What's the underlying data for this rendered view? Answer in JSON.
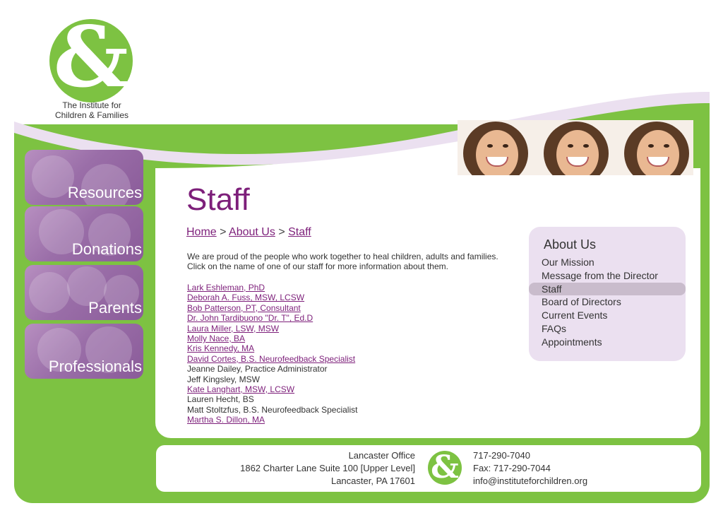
{
  "logo": {
    "symbol": "&",
    "line1": "The Institute for",
    "line2": "Children & Families"
  },
  "colors": {
    "brand_green": "#7dc242",
    "brand_purple": "#7d1f7a",
    "lavender": "#ebe0f0"
  },
  "sidebar": {
    "items": [
      {
        "label": "Resources"
      },
      {
        "label": "Donations"
      },
      {
        "label": "Parents"
      },
      {
        "label": "Professionals"
      }
    ]
  },
  "page": {
    "title": "Staff",
    "breadcrumb": {
      "home": "Home",
      "sep1": ">",
      "about": "About Us",
      "sep2": ">",
      "current": "Staff"
    },
    "intro_line1": "We are proud of the people who work together to heal children, adults and families.",
    "intro_line2": "Click on the name of one of our staff for more information about them."
  },
  "staff": [
    {
      "name": "Lark Eshleman, PhD",
      "linked": true
    },
    {
      "name": "Deborah A. Fuss, MSW, LCSW",
      "linked": true
    },
    {
      "name": "Bob Patterson, PT, Consultant",
      "linked": true
    },
    {
      "name": "Dr. John Tardibuono \"Dr. T\", Ed.D",
      "linked": true
    },
    {
      "name": "Laura Miller, LSW, MSW",
      "linked": true
    },
    {
      "name": "Molly Nace, BA",
      "linked": true
    },
    {
      "name": "Kris Kennedy, MA",
      "linked": true
    },
    {
      "name": "David Cortes, B.S. Neurofeedback Specialist",
      "linked": true
    },
    {
      "name": "Jeanne Dailey, Practice Administrator",
      "linked": false
    },
    {
      "name": "Jeff Kingsley, MSW",
      "linked": false
    },
    {
      "name": "Kate Langhart, MSW, LCSW",
      "linked": true
    },
    {
      "name": "Lauren Hecht, BS",
      "linked": false
    },
    {
      "name": "Matt Stoltzfus, B.S. Neurofeedback Specialist",
      "linked": false
    },
    {
      "name": "Martha S. Dillon, MA",
      "linked": true
    }
  ],
  "about_menu": {
    "title": "About Us",
    "items": [
      {
        "label": "Our Mission",
        "active": false
      },
      {
        "label": "Message from the Director",
        "active": false
      },
      {
        "label": "Staff",
        "active": true
      },
      {
        "label": "Board of Directors",
        "active": false
      },
      {
        "label": "Current Events",
        "active": false
      },
      {
        "label": "FAQs",
        "active": false
      },
      {
        "label": "Appointments",
        "active": false
      }
    ]
  },
  "footer": {
    "office": "Lancaster Office",
    "address1": "1862 Charter Lane Suite 100 [Upper Level]",
    "address2": "Lancaster, PA 17601",
    "phone": "717-290-7040",
    "fax": "Fax: 717-290-7044",
    "email": "info@instituteforchildren.org"
  }
}
